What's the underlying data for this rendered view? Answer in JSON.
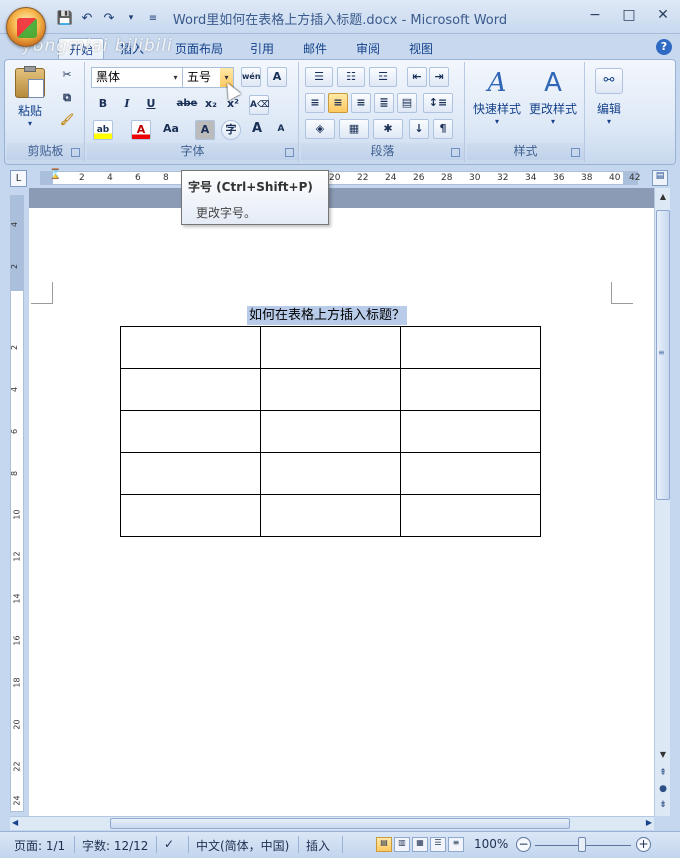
{
  "window": {
    "title": "Word里如何在表格上方插入标题.docx - Microsoft Word",
    "watermark": "yongmlai bilibili"
  },
  "qat": {
    "customize": "₹"
  },
  "tabs": [
    "开始",
    "插入",
    "页面布局",
    "引用",
    "邮件",
    "审阅",
    "视图"
  ],
  "ribbon": {
    "clipboard": {
      "label": "剪贴板",
      "paste": "粘贴"
    },
    "font": {
      "label": "字体",
      "font_name": "黑体",
      "font_size": "五号",
      "bold": "B",
      "italic": "I",
      "underline": "U",
      "strike": "abe",
      "subscript": "x₂",
      "superscript": "x²",
      "grow": "A",
      "shrink": "A",
      "case": "Aa",
      "char_shading": "A",
      "enclose": "字",
      "phonetic": "wén",
      "char_border": "A",
      "highlight": "ab",
      "font_color": "A"
    },
    "paragraph": {
      "label": "段落"
    },
    "styles": {
      "label": "样式",
      "quick": "快速样式",
      "change": "更改样式"
    },
    "editing": {
      "label": "编辑"
    }
  },
  "tooltip": {
    "title": "字号 (Ctrl+Shift+P)",
    "desc": "更改字号。"
  },
  "ruler": {
    "h_numbers": [
      "2",
      "4",
      "6",
      "8",
      "20",
      "22",
      "24",
      "26",
      "28",
      "30",
      "32",
      "34",
      "36",
      "38",
      "40",
      "42"
    ],
    "v_numbers": [
      "4",
      "2",
      "2",
      "4",
      "6",
      "8",
      "10",
      "12",
      "14",
      "16",
      "18",
      "20",
      "22",
      "24"
    ]
  },
  "document": {
    "heading": "如何在表格上方插入标题？",
    "table": {
      "rows": 5,
      "cols": 3
    }
  },
  "statusbar": {
    "page": "页面: 1/1",
    "words": "字数: 12/12",
    "language": "中文(简体，中国)",
    "mode": "插入",
    "zoom": "100%"
  }
}
